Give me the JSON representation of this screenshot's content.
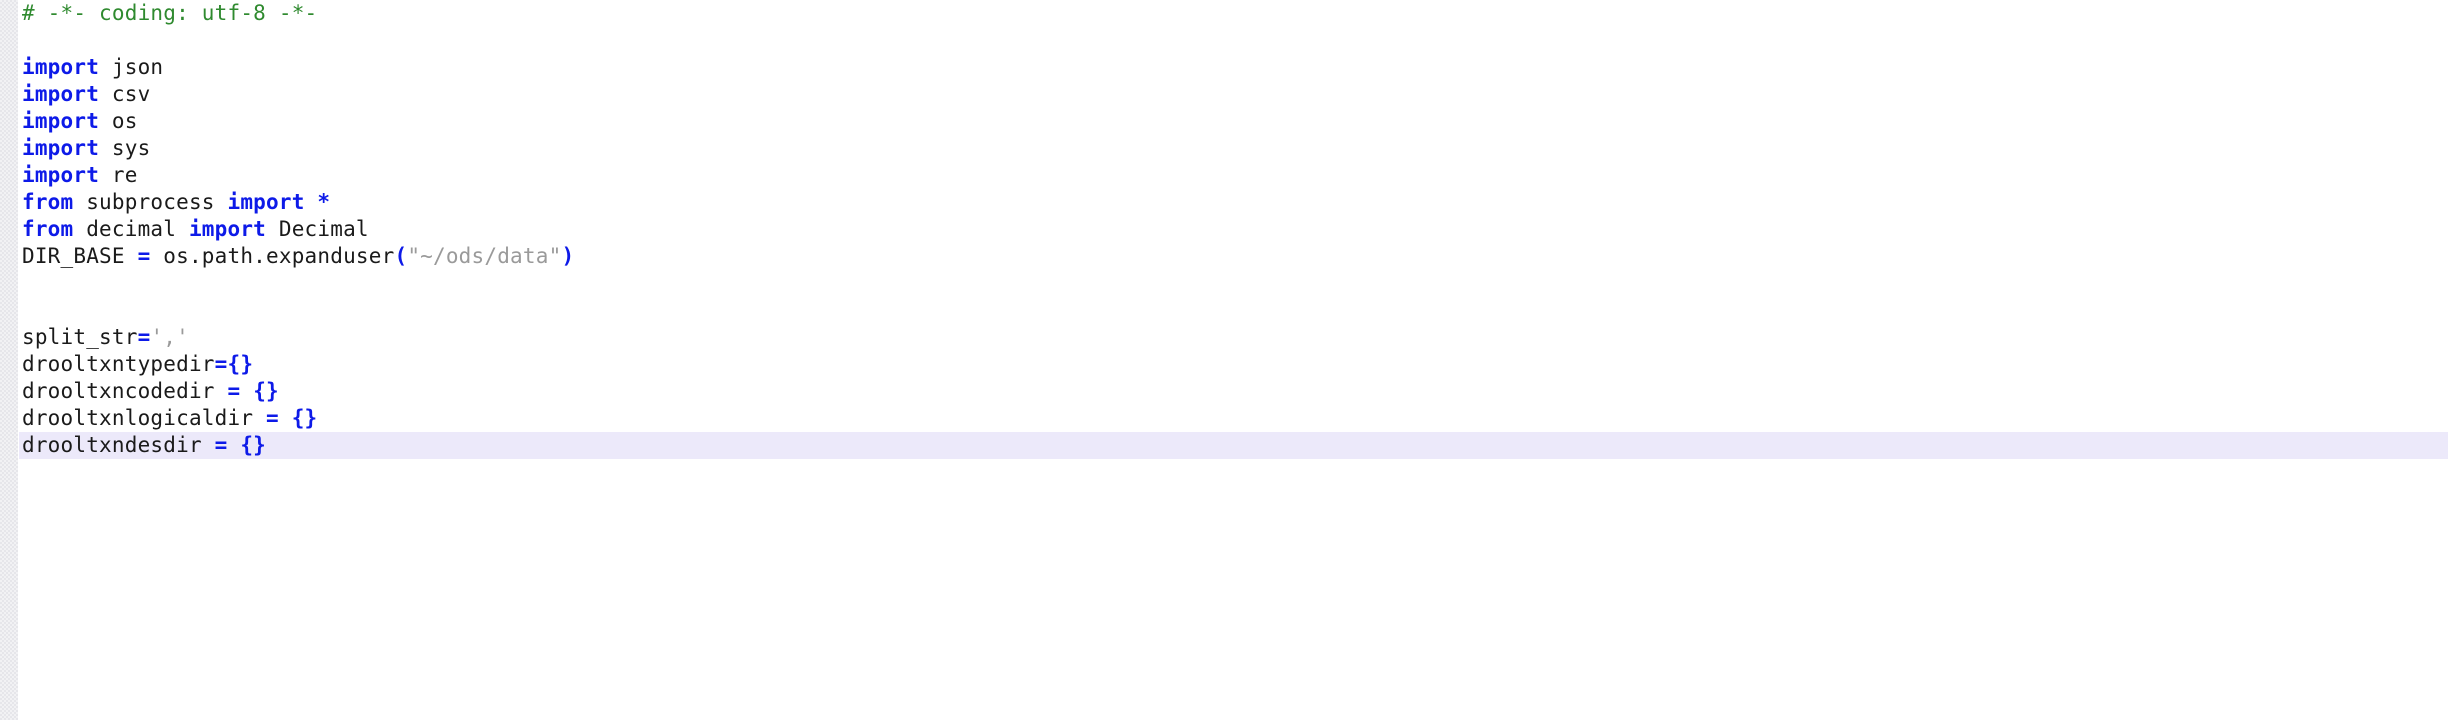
{
  "editor": {
    "language": "python",
    "font_size_px": 21,
    "line_height_px": 27,
    "colors": {
      "background": "#ffffff",
      "gutter": "#f2f2f4",
      "comment": "#2f8a2f",
      "keyword": "#0d1ae8",
      "operator": "#0d1ae8",
      "plain": "#1a1a1a",
      "string": "#9a9a9a",
      "current_line_highlight": "#ece9fa"
    },
    "current_line_index": 16
  },
  "lines": [
    {
      "index": 0,
      "text": "# -*- coding: utf-8 -*-",
      "highlighted": false,
      "tokens": [
        {
          "t": "# -*- coding: utf-8 -*-",
          "k": "comment"
        }
      ]
    },
    {
      "index": 1,
      "text": "",
      "highlighted": false,
      "tokens": []
    },
    {
      "index": 2,
      "text": "import json",
      "highlighted": false,
      "tokens": [
        {
          "t": "import",
          "k": "keyword"
        },
        {
          "t": " json",
          "k": "plain"
        }
      ]
    },
    {
      "index": 3,
      "text": "import csv",
      "highlighted": false,
      "tokens": [
        {
          "t": "import",
          "k": "keyword"
        },
        {
          "t": " csv",
          "k": "plain"
        }
      ]
    },
    {
      "index": 4,
      "text": "import os",
      "highlighted": false,
      "tokens": [
        {
          "t": "import",
          "k": "keyword"
        },
        {
          "t": " os",
          "k": "plain"
        }
      ]
    },
    {
      "index": 5,
      "text": "import sys",
      "highlighted": false,
      "tokens": [
        {
          "t": "import",
          "k": "keyword"
        },
        {
          "t": " sys",
          "k": "plain"
        }
      ]
    },
    {
      "index": 6,
      "text": "import re",
      "highlighted": false,
      "tokens": [
        {
          "t": "import",
          "k": "keyword"
        },
        {
          "t": " re",
          "k": "plain"
        }
      ]
    },
    {
      "index": 7,
      "text": "from subprocess import *",
      "highlighted": false,
      "tokens": [
        {
          "t": "from",
          "k": "keyword"
        },
        {
          "t": " subprocess ",
          "k": "plain"
        },
        {
          "t": "import",
          "k": "keyword"
        },
        {
          "t": " ",
          "k": "plain"
        },
        {
          "t": "*",
          "k": "operator"
        }
      ]
    },
    {
      "index": 8,
      "text": "from decimal import Decimal",
      "highlighted": false,
      "tokens": [
        {
          "t": "from",
          "k": "keyword"
        },
        {
          "t": " decimal ",
          "k": "plain"
        },
        {
          "t": "import",
          "k": "keyword"
        },
        {
          "t": " Decimal",
          "k": "plain"
        }
      ]
    },
    {
      "index": 9,
      "text": "DIR_BASE = os.path.expanduser(\"~/ods/data\")",
      "highlighted": false,
      "tokens": [
        {
          "t": "DIR_BASE ",
          "k": "plain"
        },
        {
          "t": "=",
          "k": "operator"
        },
        {
          "t": " os.path.expanduser",
          "k": "plain"
        },
        {
          "t": "(",
          "k": "operator"
        },
        {
          "t": "\"~/ods/data\"",
          "k": "string"
        },
        {
          "t": ")",
          "k": "operator"
        }
      ]
    },
    {
      "index": 10,
      "text": "",
      "highlighted": false,
      "tokens": []
    },
    {
      "index": 11,
      "text": "",
      "highlighted": false,
      "tokens": []
    },
    {
      "index": 12,
      "text": "split_str=','",
      "highlighted": false,
      "tokens": [
        {
          "t": "split_str",
          "k": "plain"
        },
        {
          "t": "=",
          "k": "operator"
        },
        {
          "t": "','",
          "k": "string"
        }
      ]
    },
    {
      "index": 13,
      "text": "drooltxntypedir={}",
      "highlighted": false,
      "tokens": [
        {
          "t": "drooltxntypedir",
          "k": "plain"
        },
        {
          "t": "=",
          "k": "operator"
        },
        {
          "t": "{}",
          "k": "operator"
        }
      ]
    },
    {
      "index": 14,
      "text": "drooltxncodedir = {}",
      "highlighted": false,
      "tokens": [
        {
          "t": "drooltxncodedir ",
          "k": "plain"
        },
        {
          "t": "=",
          "k": "operator"
        },
        {
          "t": " ",
          "k": "plain"
        },
        {
          "t": "{}",
          "k": "operator"
        }
      ]
    },
    {
      "index": 15,
      "text": "drooltxnlogicaldir = {}",
      "highlighted": false,
      "tokens": [
        {
          "t": "drooltxnlogicaldir ",
          "k": "plain"
        },
        {
          "t": "=",
          "k": "operator"
        },
        {
          "t": " ",
          "k": "plain"
        },
        {
          "t": "{}",
          "k": "operator"
        }
      ]
    },
    {
      "index": 16,
      "text": "drooltxndesdir = {}",
      "highlighted": true,
      "tokens": [
        {
          "t": "drooltxndesdir ",
          "k": "plain"
        },
        {
          "t": "=",
          "k": "operator"
        },
        {
          "t": " ",
          "k": "plain"
        },
        {
          "t": "{}",
          "k": "operator"
        }
      ]
    }
  ]
}
